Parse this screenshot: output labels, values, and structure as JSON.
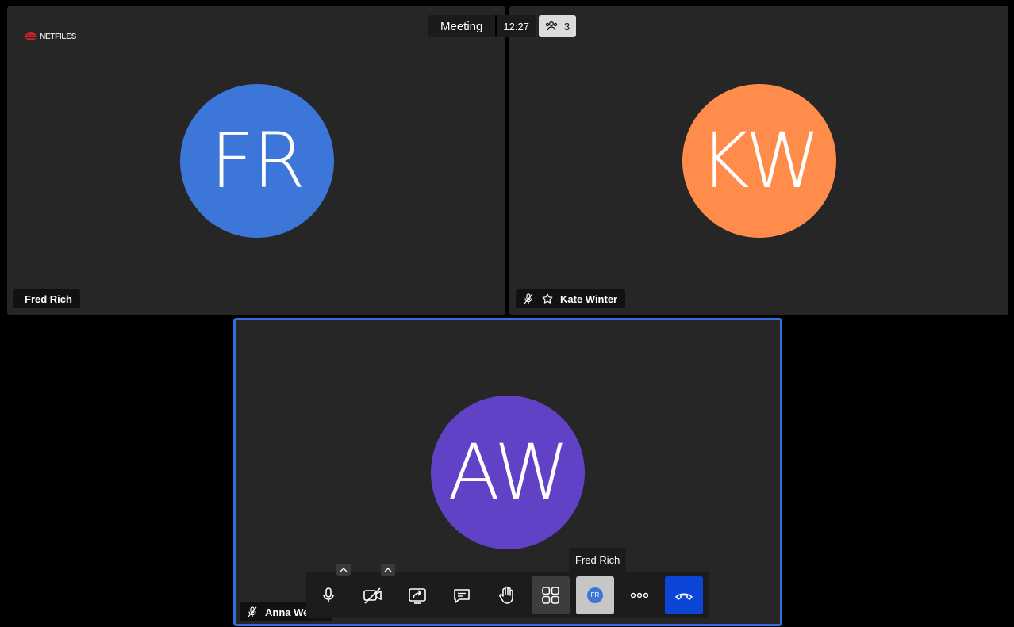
{
  "meeting": {
    "title": "Meeting",
    "time": "12:27",
    "participant_count": "3"
  },
  "logo": {
    "text": "NETFILES",
    "color": "#d0202a"
  },
  "participants": [
    {
      "initials": "FR",
      "name": "Fred Rich",
      "avatar_color": "#3b76d8",
      "muted": false,
      "moderator": false
    },
    {
      "initials": "KW",
      "name": "Kate Winter",
      "avatar_color": "#ff8c4a",
      "muted": true,
      "moderator": true
    },
    {
      "initials": "AW",
      "name": "Anna We",
      "avatar_color": "#6141c6",
      "muted": true,
      "moderator": false,
      "active_speaker": true
    }
  ],
  "toolbar": {
    "buttons": [
      "microphone-icon",
      "camera-off-icon",
      "share-screen-icon",
      "chat-icon",
      "raise-hand-icon",
      "tile-view-icon",
      "self-avatar",
      "more-icon",
      "hangup-icon"
    ],
    "self_initials": "FR",
    "tooltip": "Fred Rich",
    "hangup_color": "#0c46d6"
  },
  "colors": {
    "active_border": "#2f6fe0",
    "tile_bg": "#262626"
  }
}
